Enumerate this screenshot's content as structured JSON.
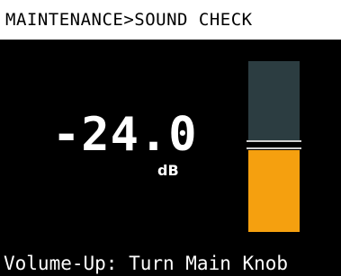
{
  "header": {
    "breadcrumb": "MAINTENANCE>SOUND CHECK"
  },
  "readout": {
    "value": "-24.0",
    "unit": "dB"
  },
  "meter": {
    "level_fraction": 0.48,
    "fill_color": "#f5a00f",
    "empty_color": "#2c3d41",
    "marker_color": "#d0d0d0"
  },
  "footer": {
    "hint": "Volume-Up: Turn Main Knob"
  }
}
